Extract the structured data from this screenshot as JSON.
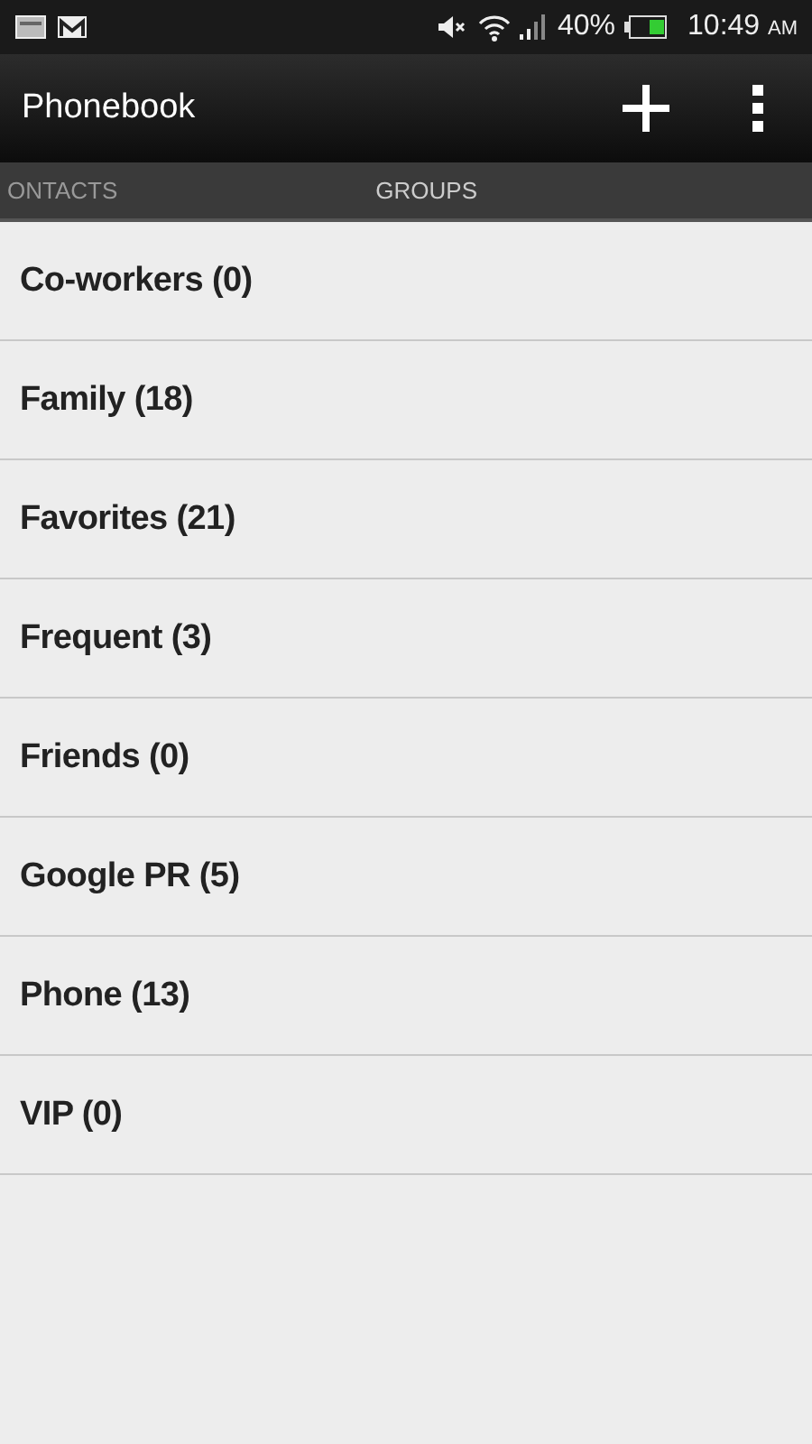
{
  "status_bar": {
    "battery": "40%",
    "time": "10:49",
    "time_suffix": "AM"
  },
  "action_bar": {
    "title": "Phonebook"
  },
  "tabs": [
    {
      "label": "ONTACTS"
    },
    {
      "label": "GROUPS"
    }
  ],
  "groups": [
    {
      "name": "Co-workers (0)"
    },
    {
      "name": "Family (18)"
    },
    {
      "name": "Favorites (21)"
    },
    {
      "name": "Frequent (3)"
    },
    {
      "name": "Friends (0)"
    },
    {
      "name": "Google PR (5)"
    },
    {
      "name": "Phone (13)"
    },
    {
      "name": "VIP (0)"
    }
  ]
}
